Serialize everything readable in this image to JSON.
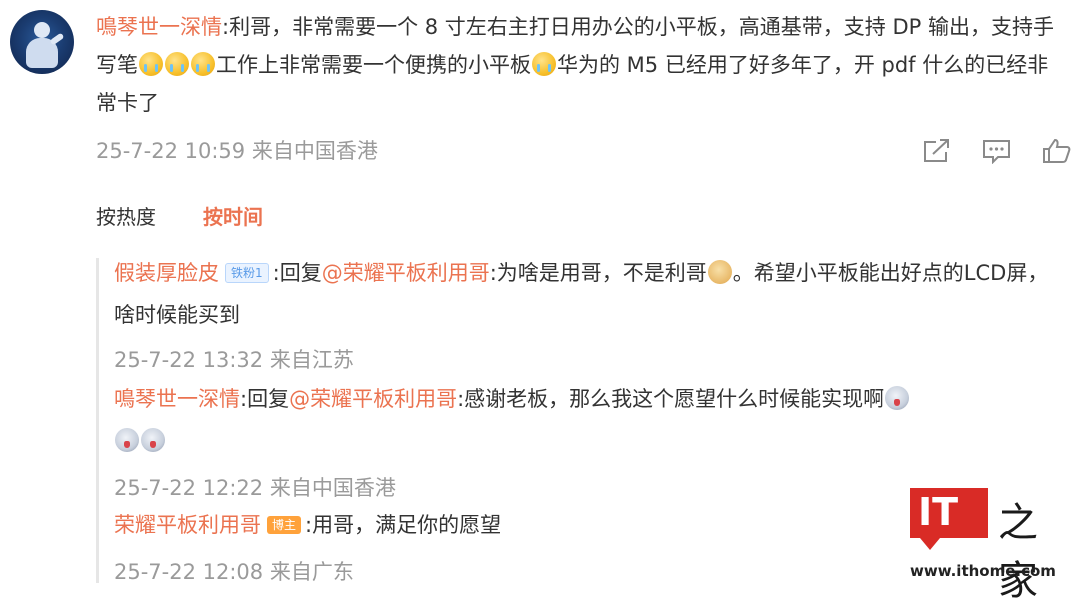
{
  "main_comment": {
    "username": "鳴琴世一深情",
    "text_before_emoji": ":利哥，非常需要一个 8 寸左右主打日用办公的小平板，高通基带，支持 DP 输出，支持手写笔",
    "text_middle": "工作上非常需要一个便携的小平板",
    "text_after_emoji": "华为的 M5 已经用了好多年了，开 pdf 什么的已经非常卡了",
    "emojis": [
      "cry-emoji",
      "cry-emoji",
      "cry-emoji",
      "cry-emoji"
    ],
    "timestamp": "25-7-22 10:59 来自中国香港"
  },
  "actions": {
    "icons": [
      "share-icon",
      "comment-icon",
      "like-icon"
    ]
  },
  "sort_tabs": {
    "hot": "按热度",
    "time": "按时间",
    "active": "time"
  },
  "replies": [
    {
      "username": "假装厚脸皮",
      "badge": "铁粉1",
      "reply_prefix": ":回复",
      "mention": "@荣耀平板利用哥",
      "text": ":为啥是用哥，不是利哥",
      "text_after_emoji": "。希望小平板能出好点的LCD屏，啥时候能买到",
      "timestamp": "25-7-22 13:32 来自江苏"
    },
    {
      "username": "鳴琴世一深情",
      "reply_prefix": ":回复",
      "mention": "@荣耀平板利用哥",
      "text": ":感谢老板，那么我这个愿望什么时候能实现啊",
      "timestamp": "25-7-22 12:22 来自中国香港"
    },
    {
      "username": "荣耀平板利用哥",
      "badge": "博主",
      "text": ":用哥，满足你的愿望",
      "timestamp": "25-7-22 12:08 来自广东"
    }
  ],
  "watermark": {
    "logo_text": "IT",
    "chars": "之家",
    "url": "www.ithome.com"
  },
  "colors": {
    "accent": "#eb7350",
    "meta_gray": "#9a9a9a",
    "text": "#333333",
    "logo_red": "#d92b26"
  }
}
